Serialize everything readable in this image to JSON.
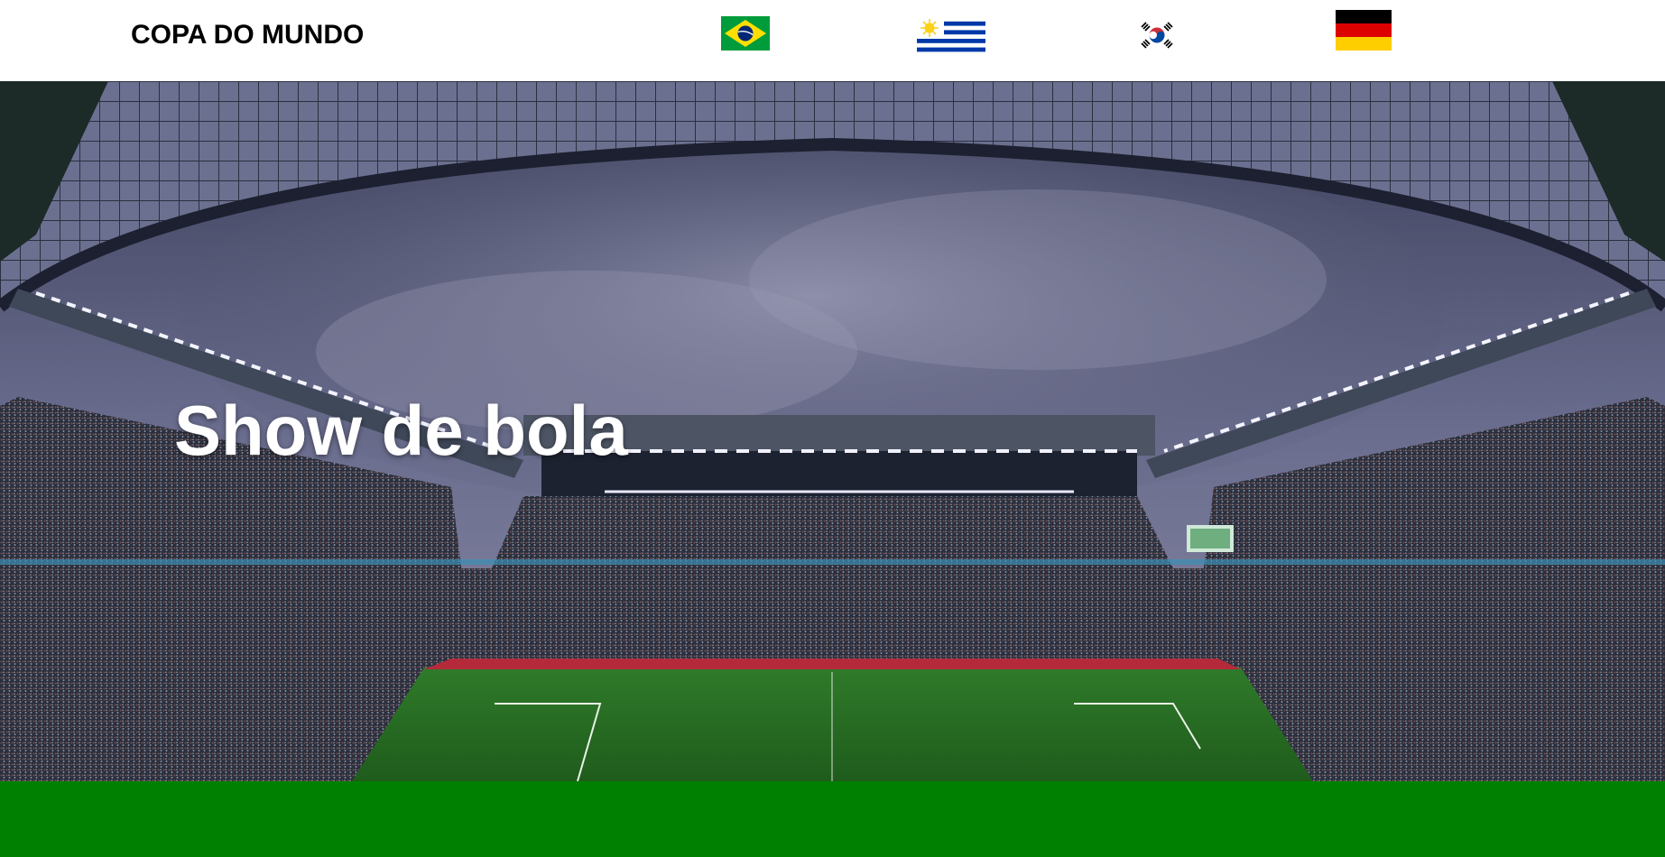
{
  "header": {
    "brand": "COPA DO MUNDO",
    "flags": [
      {
        "name": "brazil-flag-icon",
        "country": "Brasil"
      },
      {
        "name": "uruguay-flag-icon",
        "country": "Uruguai"
      },
      {
        "name": "south-korea-flag-icon",
        "country": "Coreia do Sul"
      },
      {
        "name": "germany-flag-icon",
        "country": "Alemanha"
      }
    ]
  },
  "hero": {
    "headline": "Show de bola",
    "image": "stadium-photo"
  },
  "colors": {
    "footer": "#008000",
    "header_bg": "#ffffff",
    "headline": "#ffffff"
  }
}
